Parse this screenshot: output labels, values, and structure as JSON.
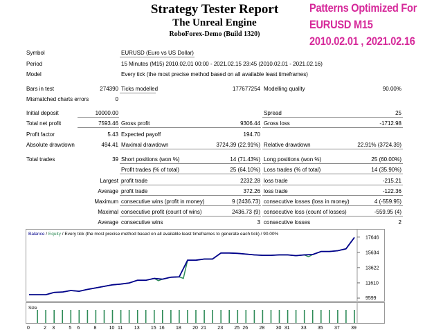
{
  "header": {
    "title": "Strategy Tester Report",
    "subtitle": "The Unreal Engine",
    "server": "RoboForex-Demo (Build 1320)"
  },
  "promo": {
    "line1": "Patterns Optimized For",
    "line2": "EURUSD M15",
    "line3": "2010.02.01 , 2021.02.16",
    "color": "#d6299a"
  },
  "info": {
    "symbol_label": "Symbol",
    "symbol": "EURUSD (Euro vs US Dollar)",
    "period_label": "Period",
    "period": "15 Minutes (M15) 2010.02.01 00:00 - 2021.02.15 23:45 (2010.02.01 - 2021.02.16)",
    "model_label": "Model",
    "model": "Every tick (the most precise method based on all available least timeframes)"
  },
  "stats": {
    "bars_label": "Bars in test",
    "bars": "274390",
    "ticks_label": "Ticks modelled",
    "ticks": "177677254",
    "quality_label": "Modelling quality",
    "quality": "90.00%",
    "mismatch_label": "Mismatched charts errors",
    "mismatch": "0",
    "deposit_label": "Initial deposit",
    "deposit": "10000.00",
    "spread_label": "Spread",
    "spread": "25",
    "net_label": "Total net profit",
    "net": "7593.46",
    "gprofit_label": "Gross profit",
    "gprofit": "9306.44",
    "gloss_label": "Gross loss",
    "gloss": "-1712.98",
    "pf_label": "Profit factor",
    "pf": "5.43",
    "payoff_label": "Expected payoff",
    "payoff": "194.70",
    "absdd_label": "Absolute drawdown",
    "absdd": "494.41",
    "maxdd_label": "Maximal drawdown",
    "maxdd": "3724.39 (22.91%)",
    "reldd_label": "Relative drawdown",
    "reldd": "22.91% (3724.39)",
    "trades_label": "Total trades",
    "trades": "39",
    "short_label": "Short positions (won %)",
    "short": "14 (71.43%)",
    "long_label": "Long positions (won %)",
    "long": "25 (60.00%)",
    "ptrades_label": "Profit trades (% of total)",
    "ptrades": "25 (64.10%)",
    "ltrades_label": "Loss trades (% of total)",
    "ltrades": "14 (35.90%)",
    "largest_label": "Largest",
    "lp_label": "profit trade",
    "lp": "2232.28",
    "ll_label": "loss trade",
    "ll": "-215.21",
    "average_label": "Average",
    "ap_label": "profit trade",
    "ap": "372.26",
    "al_label": "loss trade",
    "al": "-122.36",
    "maximum_label": "Maximum",
    "mcw_label": "consecutive wins (profit in money)",
    "mcw": "9 (2436.73)",
    "mcl_label": "consecutive losses (loss in money)",
    "mcl": "4 (-559.95)",
    "maximal_label": "Maximal",
    "mcp_label": "consecutive profit (count of wins)",
    "mcp": "2436.73 (9)",
    "mcls_label": "consecutive loss (count of losses)",
    "mcls": "-559.95 (4)",
    "average2_label": "Average",
    "acw_label": "consecutive wins",
    "acw": "3",
    "acl_label": "consecutive losses",
    "acl": "2"
  },
  "chart_data": {
    "type": "line",
    "legend_balance": "Balance",
    "legend_sep": " / ",
    "legend_equity": "Equity",
    "legend_rest": " / Every tick (the most precise method based on all available least timeframes to generate each tick) / 90.00%",
    "size_label": "Size",
    "colors": {
      "balance": "#00008b",
      "equity": "#2e8b57",
      "size_bars": "#2e8b57"
    },
    "ylim": [
      9599,
      17900
    ],
    "y_ticks": [
      9599,
      11610,
      13622,
      15634,
      17646
    ],
    "x_ticks": [
      0,
      2,
      3,
      5,
      6,
      8,
      10,
      11,
      13,
      15,
      16,
      18,
      20,
      21,
      23,
      25,
      26,
      28,
      30,
      31,
      33,
      35,
      37,
      39
    ],
    "x_ticks_x": [
      0,
      2,
      3,
      5,
      6,
      8,
      10,
      11,
      13,
      15,
      16,
      18,
      20,
      21,
      23,
      25,
      26,
      28,
      30,
      31,
      33,
      35,
      37,
      39
    ],
    "balance": [
      [
        0,
        10050
      ],
      [
        2,
        10050
      ],
      [
        3,
        10350
      ],
      [
        4,
        10400
      ],
      [
        5,
        10600
      ],
      [
        6,
        10500
      ],
      [
        7,
        10750
      ],
      [
        8,
        10950
      ],
      [
        9,
        11150
      ],
      [
        10,
        11350
      ],
      [
        11,
        11450
      ],
      [
        12,
        11600
      ],
      [
        13,
        11950
      ],
      [
        14,
        11950
      ],
      [
        15,
        12200
      ],
      [
        16,
        12100
      ],
      [
        17,
        12350
      ],
      [
        18,
        12400
      ],
      [
        19,
        14600
      ],
      [
        20,
        14600
      ],
      [
        21,
        14750
      ],
      [
        22,
        14750
      ],
      [
        23,
        15550
      ],
      [
        24,
        15550
      ],
      [
        25,
        15500
      ],
      [
        26,
        15400
      ],
      [
        27,
        15300
      ],
      [
        28,
        15250
      ],
      [
        29,
        15250
      ],
      [
        30,
        15300
      ],
      [
        31,
        15300
      ],
      [
        32,
        15200
      ],
      [
        33,
        15300
      ],
      [
        34,
        15350
      ],
      [
        35,
        15750
      ],
      [
        36,
        15750
      ],
      [
        37,
        15850
      ],
      [
        38,
        16100
      ],
      [
        39,
        17600
      ]
    ],
    "equity_dips": [
      [
        15,
        11900
      ],
      [
        18,
        12200
      ],
      [
        33,
        15050
      ]
    ],
    "x_max": 39
  }
}
